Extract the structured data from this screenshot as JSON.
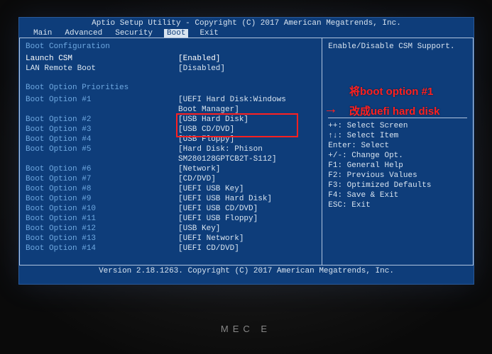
{
  "title": "Aptio Setup Utility - Copyright (C) 2017 American Megatrends, Inc.",
  "menu": [
    "Main",
    "Advanced",
    "Security",
    "Boot",
    "Exit"
  ],
  "active_menu": "Boot",
  "section_boot_config": "Boot Configuration",
  "launch_csm": {
    "label": "Launch CSM",
    "value": "[Enabled]"
  },
  "lan_remote": {
    "label": "LAN Remote Boot",
    "value": "[Disabled]"
  },
  "section_priorities": "Boot Option Priorities",
  "options": [
    {
      "label": "Boot Option #1",
      "value": "[UEFI Hard Disk:Windows",
      "value2": "Boot Manager]"
    },
    {
      "label": "Boot Option #2",
      "value": "[USB Hard Disk]"
    },
    {
      "label": "Boot Option #3",
      "value": "[USB CD/DVD]"
    },
    {
      "label": "Boot Option #4",
      "value": "[USB Floppy]"
    },
    {
      "label": "Boot Option #5",
      "value": "[Hard Disk: Phison",
      "value2": "SM280128GPTCB2T-S112]"
    },
    {
      "label": "Boot Option #6",
      "value": "[Network]"
    },
    {
      "label": "Boot Option #7",
      "value": "[CD/DVD]"
    },
    {
      "label": "Boot Option #8",
      "value": "[UEFI USB Key]"
    },
    {
      "label": "Boot Option #9",
      "value": "[UEFI USB Hard Disk]"
    },
    {
      "label": "Boot Option #10",
      "value": "[UEFI USB CD/DVD]"
    },
    {
      "label": "Boot Option #11",
      "value": "[UEFI USB Floppy]"
    },
    {
      "label": "Boot Option #12",
      "value": "[USB Key]"
    },
    {
      "label": "Boot Option #13",
      "value": "[UEFI Network]"
    },
    {
      "label": "Boot Option #14",
      "value": "[UEFI CD/DVD]"
    }
  ],
  "help_text": "Enable/Disable CSM Support.",
  "help_keys": [
    "++: Select Screen",
    "↑↓: Select Item",
    "Enter: Select",
    "+/-: Change Opt.",
    "F1: General Help",
    "F2: Previous Values",
    "F3: Optimized Defaults",
    "F4: Save & Exit",
    "ESC: Exit"
  ],
  "footer": "Version 2.18.1263. Copyright (C) 2017 American Megatrends, Inc.",
  "brand": "MEC E  ",
  "annotation": {
    "line1": "将boot option #1",
    "line2": "改成uefi hard disk"
  }
}
